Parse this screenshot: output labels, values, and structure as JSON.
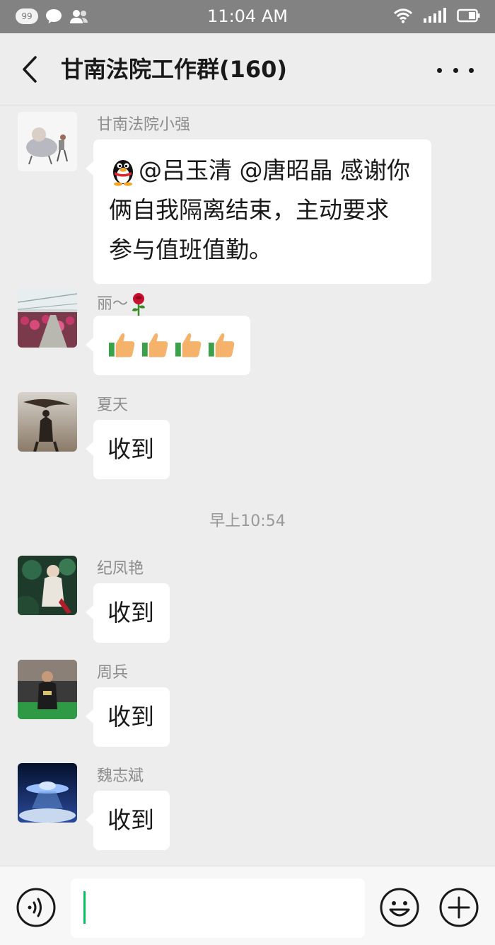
{
  "status_bar": {
    "badge": "99",
    "time": "11:04 AM"
  },
  "header": {
    "title": "甘南法院工作群(160)"
  },
  "messages": [
    {
      "sender": "甘南法院小强",
      "text": "@吕玉清 @唐昭晶 感谢你俩自我隔离结束，主动要求参与值班值勤。",
      "line1": "@吕玉清 @唐昭晶 感谢你",
      "line2": "俩自我隔离结束，主动要求",
      "line3": "参与值班值勤。"
    },
    {
      "sender": "丽～",
      "text": "👍👍👍👍"
    },
    {
      "sender": "夏天",
      "text": "收到"
    },
    {
      "sender": "纪凤艳",
      "text": "收到"
    },
    {
      "sender": "周兵",
      "text": "收到"
    },
    {
      "sender": "魏志斌",
      "text": "收到"
    }
  ],
  "time_separator": "早上10:54",
  "icons": {
    "back": "back-chevron-icon",
    "more": "more-dots-icon",
    "voice": "voice-icon",
    "emoji": "emoji-icon",
    "plus": "plus-icon"
  },
  "colors": {
    "caret": "#07c160",
    "background": "#ededed",
    "status_bar": "#828282"
  }
}
